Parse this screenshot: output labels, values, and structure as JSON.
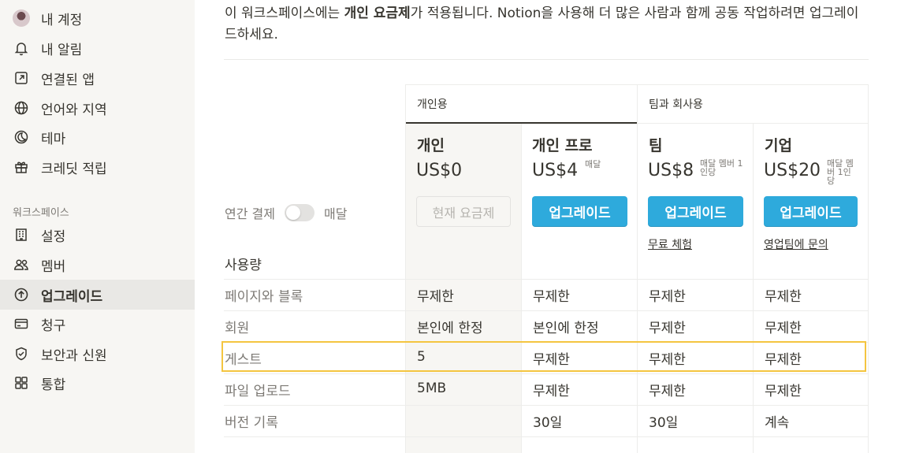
{
  "sidebar": {
    "account_items": [
      {
        "label": "내 계정",
        "icon": "avatar"
      },
      {
        "label": "내 알림",
        "icon": "bell-icon"
      },
      {
        "label": "연결된 앱",
        "icon": "external-link-icon"
      },
      {
        "label": "언어와 지역",
        "icon": "globe-icon"
      },
      {
        "label": "테마",
        "icon": "moon-icon"
      },
      {
        "label": "크레딧 적립",
        "icon": "gift-icon"
      }
    ],
    "workspace_label": "워크스페이스",
    "workspace_items": [
      {
        "label": "설정",
        "icon": "building-icon"
      },
      {
        "label": "멤버",
        "icon": "people-icon"
      },
      {
        "label": "업그레이드",
        "icon": "upgrade-arrow-icon",
        "active": true
      },
      {
        "label": "청구",
        "icon": "credit-card-icon"
      },
      {
        "label": "보안과 신원",
        "icon": "shield-icon"
      },
      {
        "label": "통합",
        "icon": "grid-icon"
      }
    ]
  },
  "intro": {
    "prefix": "이 워크스페이스에는 ",
    "bold": "개인 요금제",
    "suffix": "가 적용됩니다. Notion을 사용해 더 많은 사람과 함께 공동 작업하려면 업그레이드하세요."
  },
  "groups": {
    "personal": "개인용",
    "team": "팀과 회사용"
  },
  "billing": {
    "annual": "연간 결제",
    "monthly": "매달"
  },
  "usage_title": "사용량",
  "plans": [
    {
      "name": "개인",
      "price": "US$0",
      "unit": "",
      "button": "현재 요금제",
      "current": true,
      "link": ""
    },
    {
      "name": "개인 프로",
      "price": "US$4",
      "unit": "매달",
      "button": "업그레이드",
      "current": false,
      "link": ""
    },
    {
      "name": "팀",
      "price": "US$8",
      "unit": "매달 멤버 1인당",
      "button": "업그레이드",
      "current": false,
      "link": "무료 체험"
    },
    {
      "name": "기업",
      "price": "US$20",
      "unit": "매달 멤버 1인당",
      "button": "업그레이드",
      "current": false,
      "link": "영업팀에 문의"
    }
  ],
  "rows": [
    {
      "label": "페이지와 블록",
      "values": [
        "무제한",
        "무제한",
        "무제한",
        "무제한"
      ]
    },
    {
      "label": "회원",
      "values": [
        "본인에 한정",
        "본인에 한정",
        "무제한",
        "무제한"
      ]
    },
    {
      "label": "게스트",
      "values": [
        "5",
        "무제한",
        "무제한",
        "무제한"
      ],
      "highlighted": true
    },
    {
      "label": "파일 업로드",
      "values": [
        "5MB",
        "무제한",
        "무제한",
        "무제한"
      ]
    },
    {
      "label": "버전 기록",
      "values": [
        "",
        "30일",
        "30일",
        "계속"
      ]
    }
  ],
  "colors": {
    "accent": "#2eaadc",
    "highlight": "#f4c540",
    "sidebar_bg": "#f7f6f3"
  }
}
